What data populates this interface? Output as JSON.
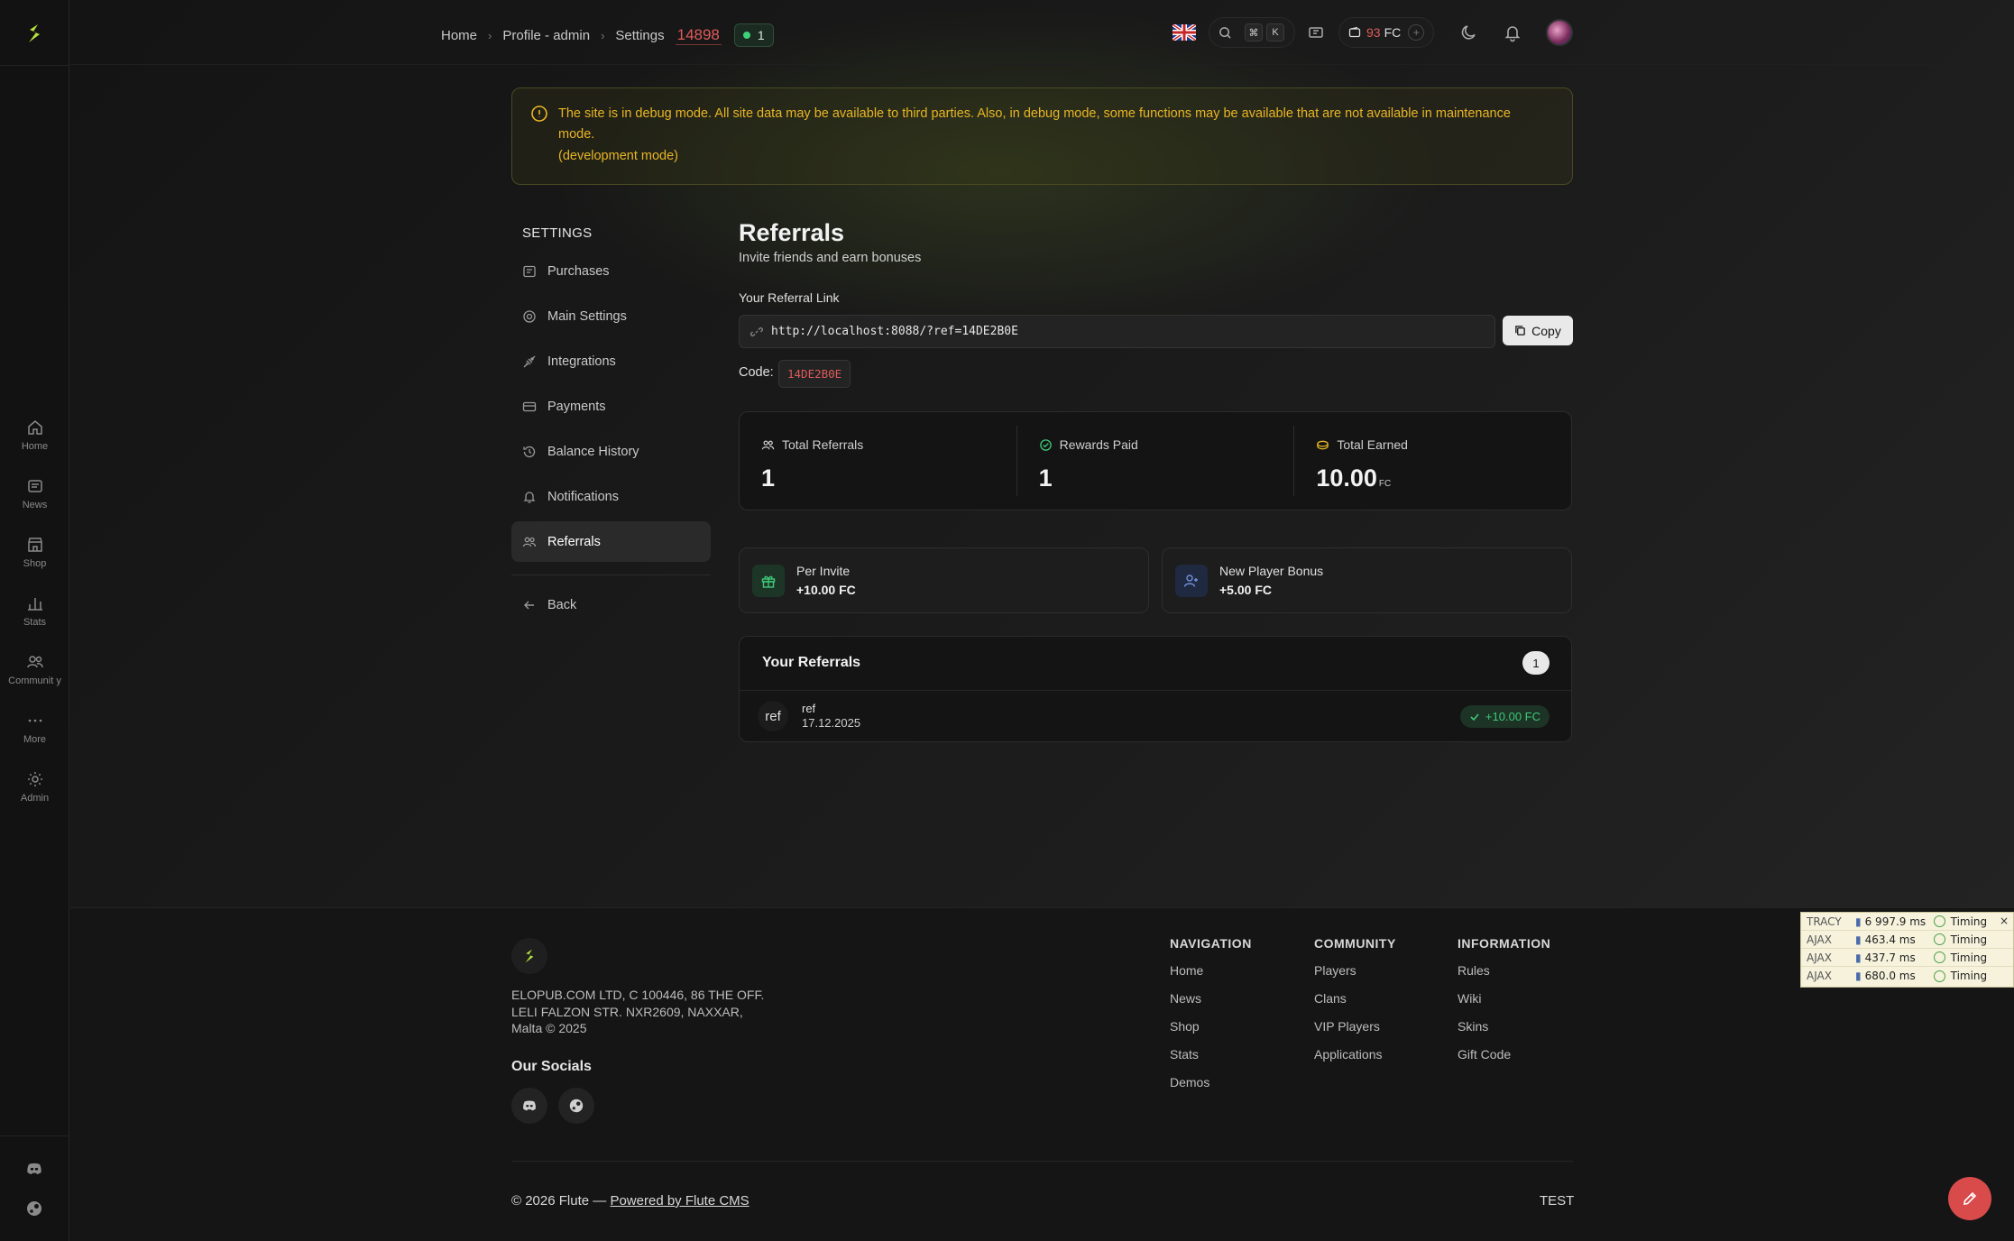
{
  "rail": {
    "items": [
      {
        "label": "Home",
        "icon": "home-icon"
      },
      {
        "label": "News",
        "icon": "news-icon"
      },
      {
        "label": "Shop",
        "icon": "shop-icon"
      },
      {
        "label": "Stats",
        "icon": "stats-icon"
      },
      {
        "label": "Communit y",
        "icon": "community-icon"
      },
      {
        "label": "More",
        "icon": "more-icon"
      },
      {
        "label": "Admin",
        "icon": "gear-icon"
      }
    ]
  },
  "topbar": {
    "breadcrumbs": [
      "Home",
      "Profile - admin",
      "Settings"
    ],
    "counter": "14898",
    "online_count": "1",
    "kbd_1": "⌘",
    "kbd_2": "K",
    "balance_amount": "93",
    "balance_unit": "FC",
    "balance_plus": "+"
  },
  "banner": {
    "text": "The site is in debug mode. All site data may be available to third parties. Also, in debug mode, some functions may be available that are not available in maintenance mode.",
    "sub": "(development mode)"
  },
  "settings": {
    "title": "SETTINGS",
    "items": [
      {
        "label": "Purchases",
        "icon": "purchases-icon"
      },
      {
        "label": "Main Settings",
        "icon": "settings-icon"
      },
      {
        "label": "Integrations",
        "icon": "integrations-icon"
      },
      {
        "label": "Payments",
        "icon": "payments-icon"
      },
      {
        "label": "Balance History",
        "icon": "history-icon"
      },
      {
        "label": "Notifications",
        "icon": "bell-icon"
      },
      {
        "label": "Referrals",
        "icon": "referrals-icon"
      }
    ],
    "back": "Back"
  },
  "referrals": {
    "title": "Referrals",
    "subtitle": "Invite friends and earn bonuses",
    "link_label": "Your Referral Link",
    "link": "http://localhost:8088/?ref=14DE2B0E",
    "copy": "Copy",
    "code_label": "Code:",
    "code": "14DE2B0E",
    "stats": [
      {
        "label": "Total Referrals",
        "value": "1",
        "unit": ""
      },
      {
        "label": "Rewards Paid",
        "value": "1",
        "unit": ""
      },
      {
        "label": "Total Earned",
        "value": "10.00",
        "unit": "FC"
      }
    ],
    "per_invite_label": "Per Invite",
    "per_invite_value": "+10.00 FC",
    "new_player_label": "New Player Bonus",
    "new_player_value": "+5.00 FC",
    "list_title": "Your Referrals",
    "list_count": "1",
    "list": [
      {
        "avatar": "ref",
        "name": "ref",
        "date": "17.12.2025",
        "reward": "+10.00 FC"
      }
    ]
  },
  "footer": {
    "address": "ELOPUB.COM LTD, C 100446, 86 THE OFF. LELI FALZON STR. NXR2609, NAXXAR, Malta © 2025",
    "socials_title": "Our Socials",
    "columns": [
      {
        "title": "NAVIGATION",
        "links": [
          "Home",
          "News",
          "Shop",
          "Stats",
          "Demos"
        ]
      },
      {
        "title": "COMMUNITY",
        "links": [
          "Players",
          "Clans",
          "VIP Players",
          "Applications"
        ]
      },
      {
        "title": "INFORMATION",
        "links": [
          "Rules",
          "Wiki",
          "Skins",
          "Gift Code"
        ]
      }
    ],
    "copyright": "© 2026 Flute —",
    "powered": "Powered by Flute CMS",
    "test": "TEST"
  },
  "tracy": {
    "rows": [
      {
        "label": "TRACY",
        "ms": "6 997.9 ms",
        "timing": "Timing"
      },
      {
        "label": "AJAX",
        "ms": "463.4 ms",
        "timing": "Timing"
      },
      {
        "label": "AJAX",
        "ms": "437.7 ms",
        "timing": "Timing"
      },
      {
        "label": "AJAX",
        "ms": "680.0 ms",
        "timing": "Timing"
      }
    ],
    "close": "×"
  },
  "colors": {
    "accent": "#b4e33d",
    "warning": "#e8b524",
    "danger": "#e05a5a",
    "success": "#3fc878"
  }
}
